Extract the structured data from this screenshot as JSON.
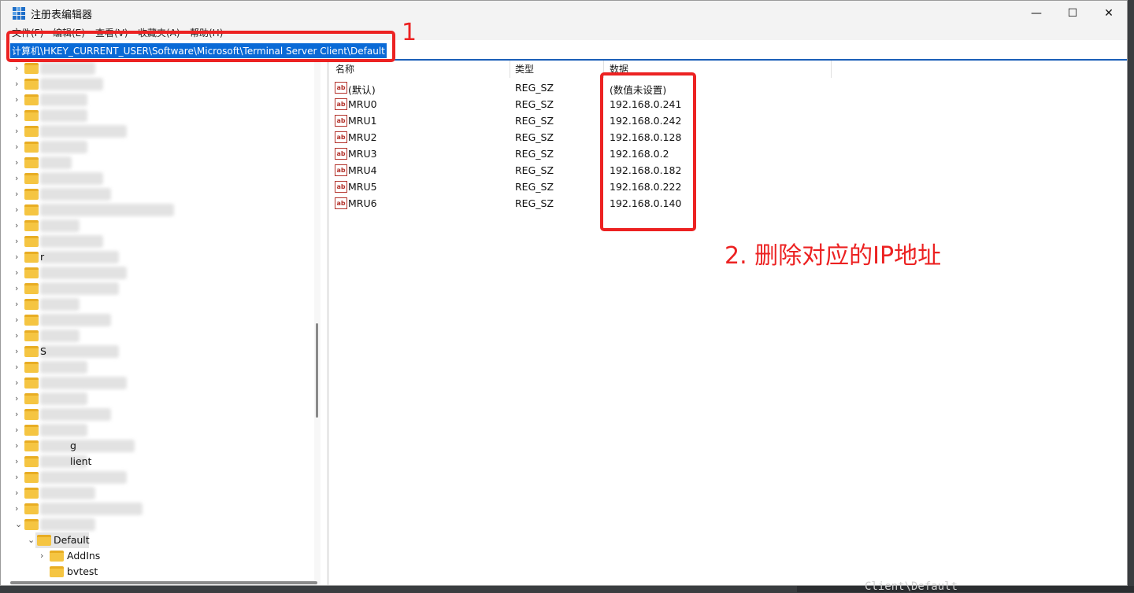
{
  "window": {
    "title": "注册表编辑器",
    "controls": {
      "minimize": "—",
      "maximize": "☐",
      "close": "✕"
    }
  },
  "menu": [
    "文件(F)",
    "编辑(E)",
    "查看(V)",
    "收藏夹(A)",
    "帮助(H)"
  ],
  "address": "计算机\\HKEY_CURRENT_USER\\Software\\Microsoft\\Terminal Server Client\\Default",
  "tree": {
    "partial_labels": [
      "r",
      "S",
      "g",
      "lient"
    ],
    "selected": "Default",
    "children": [
      "AddIns",
      "bvtest"
    ]
  },
  "list": {
    "headers": {
      "name": "名称",
      "type": "类型",
      "data": "数据"
    },
    "rows": [
      {
        "name": "(默认)",
        "type": "REG_SZ",
        "data": "(数值未设置)"
      },
      {
        "name": "MRU0",
        "type": "REG_SZ",
        "data": "192.168.0.241"
      },
      {
        "name": "MRU1",
        "type": "REG_SZ",
        "data": "192.168.0.242"
      },
      {
        "name": "MRU2",
        "type": "REG_SZ",
        "data": "192.168.0.128"
      },
      {
        "name": "MRU3",
        "type": "REG_SZ",
        "data": "192.168.0.2"
      },
      {
        "name": "MRU4",
        "type": "REG_SZ",
        "data": "192.168.0.182"
      },
      {
        "name": "MRU5",
        "type": "REG_SZ",
        "data": "192.168.0.222"
      },
      {
        "name": "MRU6",
        "type": "REG_SZ",
        "data": "192.168.0.140"
      }
    ],
    "icon_text": "ab"
  },
  "annotations": {
    "step1": "1",
    "step2": "2. 删除对应的IP地址"
  },
  "background": {
    "text": "Client\\Default"
  },
  "colors": {
    "annotation": "#ec2222",
    "selection": "#0a6ad6",
    "folder": "#f5c542"
  }
}
